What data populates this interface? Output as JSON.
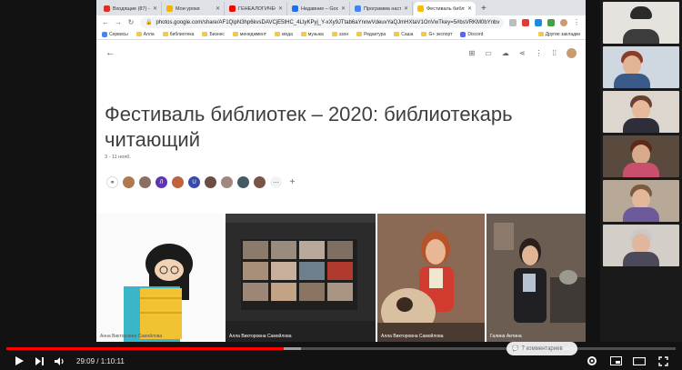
{
  "browser": {
    "tabs": [
      {
        "label": "Входящие (87) - ванд",
        "color": "#d93025",
        "active": false
      },
      {
        "label": "Мои уроки",
        "color": "#f4b400",
        "active": false
      },
      {
        "label": "ГЕНЕАЛОГИЧЕСКАЯ",
        "color": "#ff0000",
        "active": false
      },
      {
        "label": "Недавние – Google",
        "color": "#1a73e8",
        "active": false
      },
      {
        "label": "Программа настав",
        "color": "#4285f4",
        "active": false
      },
      {
        "label": "Фестиваль библиот",
        "color": "#fbbc04",
        "active": true
      }
    ],
    "url": "photos.google.com/share/AF1QipN3hp6kvsDAVCjE5tHC_4LtyKPyj_Y-xXy9JTtab6aYnnwVdeuvYaQJmHXtaV1OnVwTkey=5#bsVRKM0bYnbv",
    "bookmarks": [
      "Сервисы",
      "Алла",
      "библиотека",
      "Бизнес",
      "менеджмент",
      "мода",
      "музыка",
      "эзон",
      "Редактура",
      "Саша",
      "G+ экспорт",
      "Discord"
    ],
    "other_bookmarks": "Другие закладки"
  },
  "album": {
    "title": "Фестиваль библиотек – 2020: библиотекарь читающий",
    "date": "3 - 11 нояб.",
    "contributors": [
      {
        "letter": "",
        "color": "#b07a4c"
      },
      {
        "letter": "",
        "color": "#8d6e63"
      },
      {
        "letter": "Л",
        "color": "#5e35b1"
      },
      {
        "letter": "",
        "color": "#c0623b"
      },
      {
        "letter": "U",
        "color": "#3949ab"
      },
      {
        "letter": "",
        "color": "#6d4c41"
      },
      {
        "letter": "",
        "color": "#a1887f"
      },
      {
        "letter": "",
        "color": "#455a64"
      },
      {
        "letter": "",
        "color": "#795548"
      }
    ],
    "photos": [
      {
        "caption": "Анна Викторовна Самойлова"
      },
      {
        "caption": "Алла Викторовна Самойлова"
      },
      {
        "caption": "Алла Викторовна Самойлова"
      },
      {
        "caption": "Галина Аитина"
      }
    ]
  },
  "player": {
    "time": "29:09 / 1:10:11",
    "progress_fraction": 0.415,
    "buffer_fraction": 0.44,
    "comments": "7 комментариев"
  },
  "icons": {
    "back": "arrow-left-icon",
    "add-photos": "add-photo-icon",
    "slideshow": "slideshow-icon",
    "upload": "cloud-upload-icon",
    "share": "share-icon",
    "more": "more-vert-icon",
    "play": "play-icon",
    "next": "skip-next-icon",
    "volume": "volume-icon",
    "settings": "gear-icon",
    "miniplayer": "miniplayer-icon",
    "theater": "theater-icon",
    "fullscreen": "fullscreen-icon"
  }
}
